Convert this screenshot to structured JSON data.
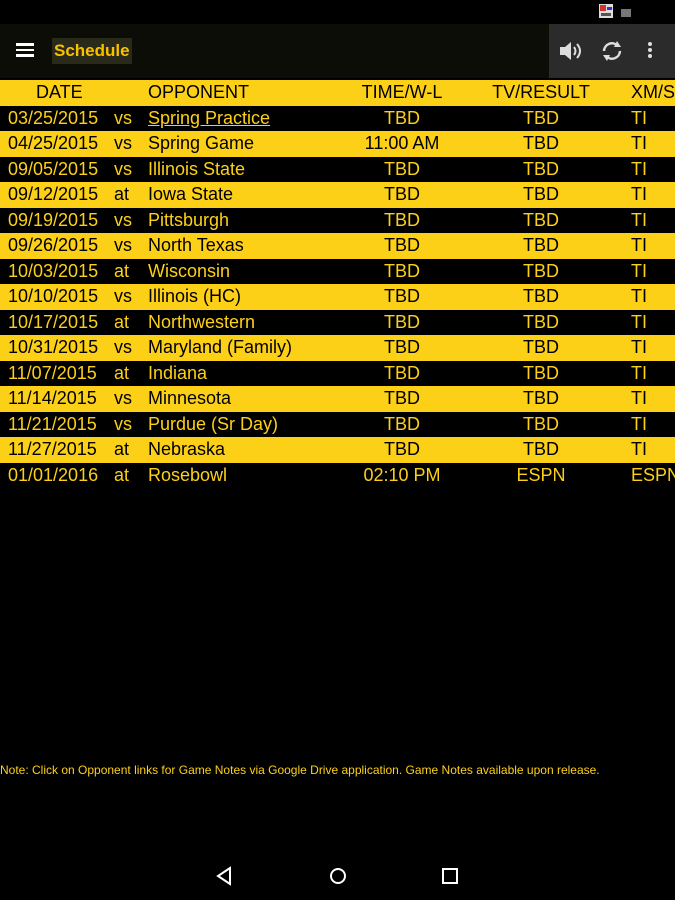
{
  "app_bar": {
    "title": "Schedule",
    "icons": [
      "menu-icon",
      "volume-icon",
      "refresh-icon",
      "overflow-menu-icon"
    ]
  },
  "table": {
    "headers": [
      "DATE",
      "OPPONENT",
      "TIME/W-L",
      "TV/RESULT",
      "XM/S"
    ],
    "rows": [
      {
        "date": "03/25/2015",
        "va": "vs",
        "opponent": "Spring Practice",
        "time": "TBD",
        "tv": "TBD",
        "xm": "TI",
        "link": true
      },
      {
        "date": "04/25/2015",
        "va": "vs",
        "opponent": "Spring Game",
        "time": "11:00 AM",
        "tv": "TBD",
        "xm": "TI"
      },
      {
        "date": "09/05/2015",
        "va": "vs",
        "opponent": "Illinois State",
        "time": "TBD",
        "tv": "TBD",
        "xm": "TI"
      },
      {
        "date": "09/12/2015",
        "va": "at",
        "opponent": "Iowa State",
        "time": "TBD",
        "tv": "TBD",
        "xm": "TI"
      },
      {
        "date": "09/19/2015",
        "va": "vs",
        "opponent": "Pittsburgh",
        "time": "TBD",
        "tv": "TBD",
        "xm": "TI"
      },
      {
        "date": "09/26/2015",
        "va": "vs",
        "opponent": "North Texas",
        "time": "TBD",
        "tv": "TBD",
        "xm": "TI"
      },
      {
        "date": "10/03/2015",
        "va": "at",
        "opponent": "Wisconsin",
        "time": "TBD",
        "tv": "TBD",
        "xm": "TI"
      },
      {
        "date": "10/10/2015",
        "va": "vs",
        "opponent": "Illinois (HC)",
        "time": "TBD",
        "tv": "TBD",
        "xm": "TI"
      },
      {
        "date": "10/17/2015",
        "va": "at",
        "opponent": "Northwestern",
        "time": "TBD",
        "tv": "TBD",
        "xm": "TI"
      },
      {
        "date": "10/31/2015",
        "va": "vs",
        "opponent": "Maryland (Family)",
        "time": "TBD",
        "tv": "TBD",
        "xm": "TI"
      },
      {
        "date": "11/07/2015",
        "va": "at",
        "opponent": "Indiana",
        "time": "TBD",
        "tv": "TBD",
        "xm": "TI"
      },
      {
        "date": "11/14/2015",
        "va": "vs",
        "opponent": "Minnesota",
        "time": "TBD",
        "tv": "TBD",
        "xm": "TI"
      },
      {
        "date": "11/21/2015",
        "va": "vs",
        "opponent": "Purdue (Sr Day)",
        "time": "TBD",
        "tv": "TBD",
        "xm": "TI"
      },
      {
        "date": "11/27/2015",
        "va": "at",
        "opponent": "Nebraska",
        "time": "TBD",
        "tv": "TBD",
        "xm": "TI"
      },
      {
        "date": "01/01/2016",
        "va": "at",
        "opponent": "Rosebowl",
        "time": "02:10 PM",
        "tv": "ESPN",
        "xm": "ESPN"
      }
    ]
  },
  "note": "Note: Click on Opponent links for Game Notes via Google Drive application. Game Notes available upon release.",
  "nav_bar": {
    "icons": [
      "back-icon",
      "home-icon",
      "recents-icon"
    ]
  },
  "colors": {
    "gold": "#fdd018",
    "black": "#000000",
    "title_text": "#f8c100"
  }
}
